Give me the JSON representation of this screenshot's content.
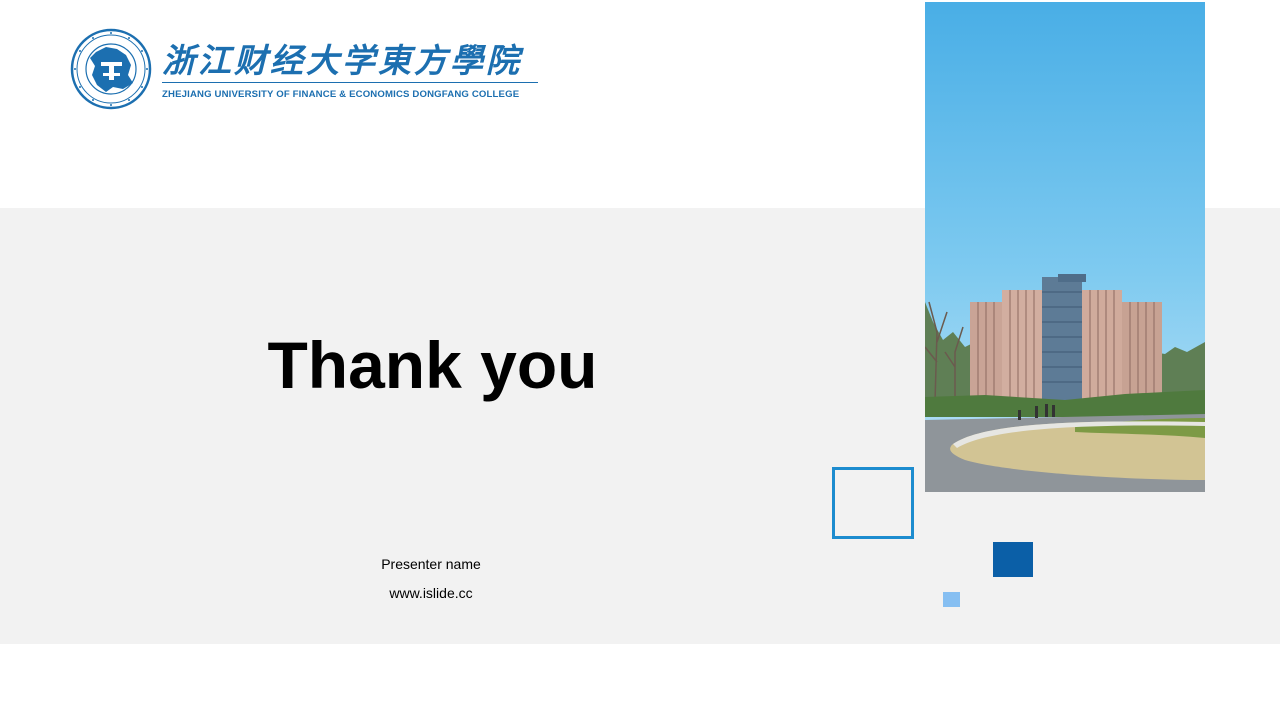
{
  "slide": {
    "logo": {
      "cn_name": "浙江财经大学東方學院",
      "en_name": "ZHEJIANG UNIVERSITY OF FINANCE & ECONOMICS DONGFANG COLLEGE",
      "icon": "university-seal-icon"
    },
    "title": "Thank you",
    "presenter": "Presenter name",
    "website": "www.islide.cc",
    "photo": {
      "icon": "campus-building-photo"
    },
    "decor": {
      "outline_square": "outline-square-icon",
      "dark_square": "dark-square-icon",
      "light_square": "light-square-icon"
    },
    "colors": {
      "brand_blue": "#1c6fb0",
      "outline_blue": "#1d8ccf",
      "dark_blue": "#0b5fa7",
      "light_blue": "#86bff2",
      "band_gray": "#f2f2f2",
      "background": "#ffffff"
    }
  }
}
